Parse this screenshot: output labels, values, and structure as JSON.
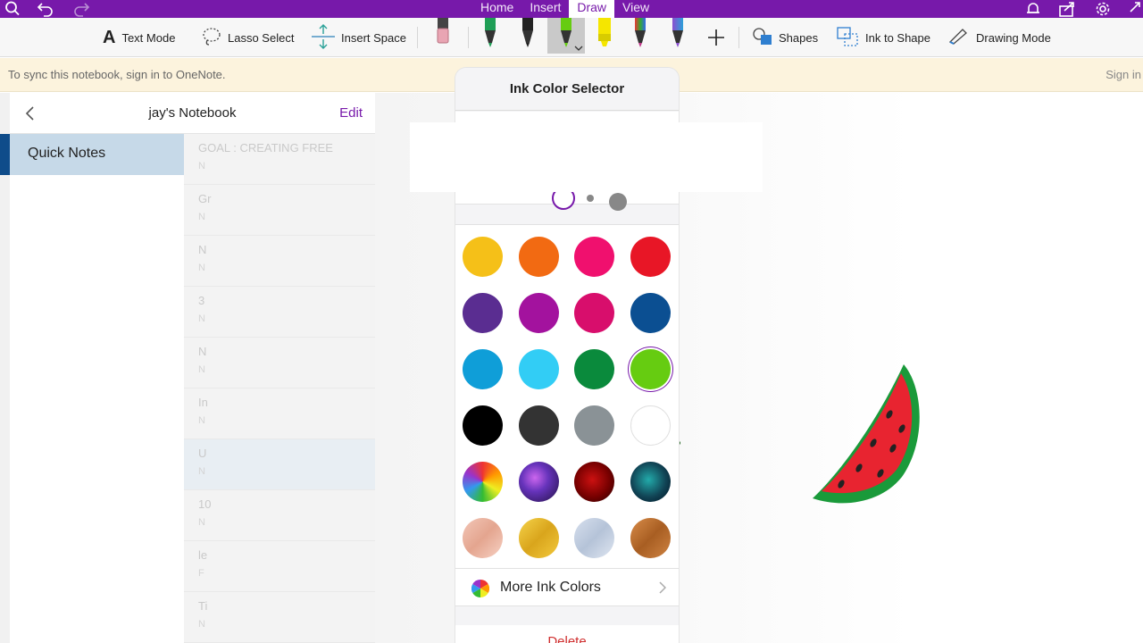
{
  "tabs": [
    {
      "label": "Home"
    },
    {
      "label": "Insert"
    },
    {
      "label": "Draw"
    },
    {
      "label": "View"
    }
  ],
  "active_tab": "Draw",
  "ribbon": {
    "text_mode": "Text Mode",
    "lasso_select": "Lasso Select",
    "insert_space": "Insert Space",
    "shapes": "Shapes",
    "ink_to_shape": "Ink to Shape",
    "drawing_mode": "Drawing Mode"
  },
  "pens": [
    {
      "icon": "eraser-icon",
      "color": "#e9a5b3"
    },
    {
      "icon": "pen-icon",
      "color": "#1f9e56"
    },
    {
      "icon": "pen-icon",
      "color": "#222222"
    },
    {
      "icon": "pen-icon",
      "color": "#66cc11",
      "selected": true
    },
    {
      "icon": "highlighter-icon",
      "color": "#f5e600"
    },
    {
      "icon": "pen-icon",
      "color": "#c03a8a"
    },
    {
      "icon": "pen-icon",
      "color": "#8a4fd0"
    }
  ],
  "banner": {
    "text": "To sync this notebook, sign in to OneNote.",
    "sign_in": "Sign in"
  },
  "notebook": {
    "title": "jay's Notebook",
    "edit": "Edit",
    "section": "Quick Notes",
    "pages": [
      {
        "title": "GOAL : CREATING FREE",
        "sub": "N"
      },
      {
        "title": "Gr",
        "sub": "N"
      },
      {
        "title": "N",
        "sub": "N"
      },
      {
        "title": "3",
        "sub": "N"
      },
      {
        "title": "N",
        "sub": "N"
      },
      {
        "title": "In",
        "sub": "N"
      },
      {
        "title": "U",
        "sub": "N",
        "selected": true
      },
      {
        "title": "10",
        "sub": "N"
      },
      {
        "title": "le",
        "sub": "F"
      },
      {
        "title": "Ti",
        "sub": "N"
      }
    ]
  },
  "popover": {
    "title": "Ink Color Selector",
    "more_colors": "More Ink Colors",
    "delete": "Delete",
    "selected_color": "#66cc11",
    "colors": [
      [
        "#f5c018",
        "#f26a12",
        "#f0106e",
        "#e81626"
      ],
      [
        "#5a2d91",
        "#a3129e",
        "#d80e6c",
        "#0b4f92"
      ],
      [
        "#0f9ed8",
        "#32cdf5",
        "#0a8a3c",
        "#66cc11"
      ],
      [
        "#000000",
        "#333333",
        "#8a9296",
        "#ffffff"
      ],
      [
        "texture-rainbow",
        "texture-galaxy",
        "texture-red-nebula",
        "texture-teal-nebula"
      ],
      [
        "texture-rose-gold",
        "texture-gold",
        "texture-silver",
        "texture-bronze"
      ]
    ]
  }
}
